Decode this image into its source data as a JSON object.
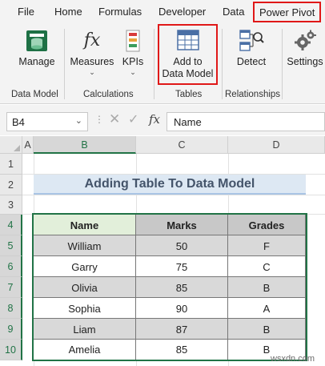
{
  "menu": {
    "items": [
      "File",
      "Home",
      "Formulas",
      "Developer",
      "Data"
    ],
    "active": "Power Pivot"
  },
  "ribbon": {
    "data_model": {
      "manage_label": "Manage",
      "group_label": "Data Model"
    },
    "calculations": {
      "measures_label": "Measures",
      "kpis_label": "KPIs",
      "group_label": "Calculations"
    },
    "tables": {
      "add_line1": "Add to",
      "add_line2": "Data Model",
      "group_label": "Tables"
    },
    "relationships": {
      "detect_label": "Detect",
      "group_label": "Relationships"
    },
    "settings_label": "Settings"
  },
  "formula_bar": {
    "name_box": "B4",
    "fx": "fx",
    "content": "Name"
  },
  "sheet": {
    "columns": [
      "A",
      "B",
      "C",
      "D"
    ],
    "rows": [
      "1",
      "2",
      "3",
      "4",
      "5",
      "6",
      "7",
      "8",
      "9",
      "10"
    ],
    "title": "Adding Table To Data Model",
    "table": {
      "headers": [
        "Name",
        "Marks",
        "Grades"
      ],
      "rows": [
        [
          "William",
          "50",
          "F"
        ],
        [
          "Garry",
          "75",
          "C"
        ],
        [
          "Olivia",
          "85",
          "B"
        ],
        [
          "Sophia",
          "90",
          "A"
        ],
        [
          "Liam",
          "87",
          "B"
        ],
        [
          "Amelia",
          "85",
          "B"
        ]
      ]
    }
  },
  "watermark": "wsxdn.com",
  "colors": {
    "accent_green": "#217346",
    "highlight_red": "#e01818",
    "title_fill": "#dde8f3",
    "name_header_fill": "#e2efda"
  },
  "icons": [
    "data-model-icon",
    "fx-measures-icon",
    "kpi-icon",
    "add-table-icon",
    "detect-relationships-icon",
    "settings-gear-icon"
  ]
}
